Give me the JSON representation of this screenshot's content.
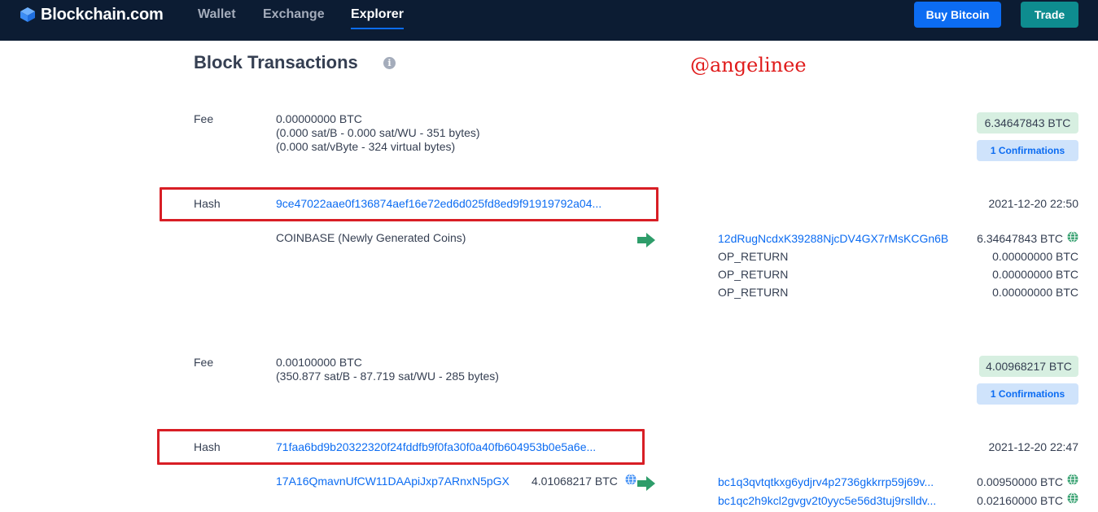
{
  "nav": {
    "logo_text": "Blockchain.com",
    "links": [
      "Wallet",
      "Exchange",
      "Explorer"
    ],
    "buy_label": "Buy Bitcoin",
    "trade_label": "Trade"
  },
  "page": {
    "title": "Block Transactions",
    "info_glyph": "i",
    "watermark": "@angelinee"
  },
  "transactions": [
    {
      "fee_label": "Fee",
      "fee_lines": [
        "0.00000000 BTC",
        "(0.000 sat/B - 0.000 sat/WU - 351 bytes)",
        "(0.000 sat/vByte - 324 virtual bytes)"
      ],
      "total": "6.34647843 BTC",
      "confirmations": "1 Confirmations",
      "hash_label": "Hash",
      "hash": "9ce47022aae0f136874aef16e72ed6d025fd8ed9f91919792a04...",
      "time": "2021-12-20 22:50",
      "input": {
        "address": "COINBASE (Newly Generated Coins)"
      },
      "outputs": [
        {
          "address": "12dRugNcdxK39288NjcDV4GX7rMsKCGn6B",
          "amount": "6.34647843 BTC"
        },
        {
          "address": "OP_RETURN",
          "amount": "0.00000000 BTC"
        },
        {
          "address": "OP_RETURN",
          "amount": "0.00000000 BTC"
        },
        {
          "address": "OP_RETURN",
          "amount": "0.00000000 BTC"
        }
      ]
    },
    {
      "fee_label": "Fee",
      "fee_lines": [
        "0.00100000 BTC",
        "(350.877 sat/B - 87.719 sat/WU - 285 bytes)"
      ],
      "total": "4.00968217 BTC",
      "confirmations": "1 Confirmations",
      "hash_label": "Hash",
      "hash": "71faa6bd9b20322320f24fddfb9f0fa30f0a40fb604953b0e5a6e...",
      "time": "2021-12-20 22:47",
      "input": {
        "address": "17A16QmavnUfCW11DAApiJxp7ARnxN5pGX",
        "amount": "4.01068217 BTC"
      },
      "outputs": [
        {
          "address": "bc1q3qvtqtkxg6ydjrv4p2736gkkrrp59j69v...",
          "amount": "0.00950000 BTC"
        },
        {
          "address": "bc1qc2h9kcl2gvgv2t0yyc5e56d3tuj9rslldv...",
          "amount": "0.02160000 BTC"
        }
      ]
    }
  ],
  "colors": {
    "nav_bg": "#0c1c33",
    "brand_blue": "#0c6cf2",
    "trade_teal": "#0e8c8f",
    "arrow_green": "#2e9d6a",
    "highlight_red": "#d81e25"
  }
}
